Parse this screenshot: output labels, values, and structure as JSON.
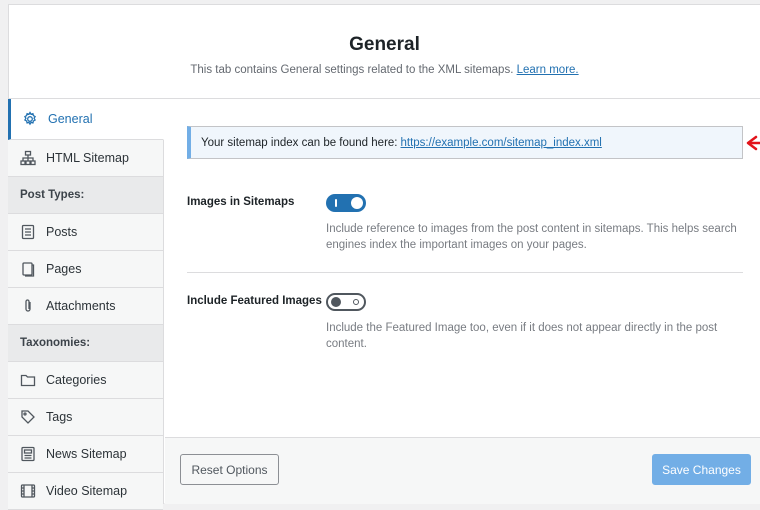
{
  "header": {
    "title": "General",
    "description": "This tab contains General settings related to the XML sitemaps.",
    "learn_more": "Learn more."
  },
  "sidebar": {
    "items": [
      {
        "label": "General",
        "icon": "gear-icon",
        "active": true
      },
      {
        "label": "HTML Sitemap",
        "icon": "sitemap-icon"
      },
      {
        "heading": "Post Types:"
      },
      {
        "label": "Posts",
        "icon": "document-icon"
      },
      {
        "label": "Pages",
        "icon": "pages-icon"
      },
      {
        "label": "Attachments",
        "icon": "paperclip-icon"
      },
      {
        "heading": "Taxonomies:"
      },
      {
        "label": "Categories",
        "icon": "folder-icon"
      },
      {
        "label": "Tags",
        "icon": "tag-icon"
      },
      {
        "label": "News Sitemap",
        "icon": "news-icon"
      },
      {
        "label": "Video Sitemap",
        "icon": "video-icon"
      }
    ]
  },
  "notice": {
    "text": "Your sitemap index can be found here:",
    "link": "https://example.com/sitemap_index.xml",
    "arrow_color": "#e2131a"
  },
  "settings": [
    {
      "label": "Images in Sitemaps",
      "enabled": true,
      "description": "Include reference to images from the post content in sitemaps. This helps search engines index the important images on your pages."
    },
    {
      "label": "Include Featured Images",
      "enabled": false,
      "description": "Include the Featured Image too, even if it does not appear directly in the post content."
    }
  ],
  "footer": {
    "reset_label": "Reset Options",
    "save_label": "Save Changes"
  },
  "colors": {
    "accent": "#2271b1",
    "save_button": "#72aee6"
  }
}
